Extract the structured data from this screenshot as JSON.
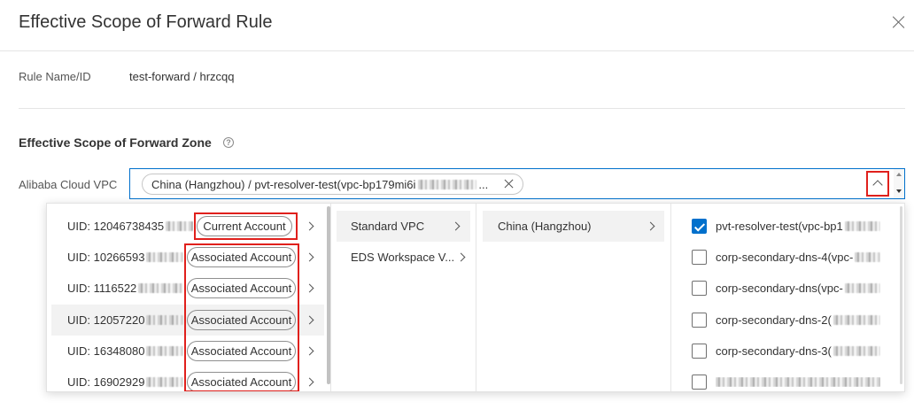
{
  "dialog": {
    "title": "Effective Scope of Forward Rule",
    "close_icon": "close-icon"
  },
  "rule": {
    "label": "Rule Name/ID",
    "value": "test-forward / hrzcqq"
  },
  "zone_section": {
    "title": "Effective Scope of Forward Zone",
    "help_icon": "question-circle-icon"
  },
  "vpc_select": {
    "label": "Alibaba Cloud VPC",
    "expanded": true,
    "toggle_icon": "chevron-up-icon",
    "selected_tag": {
      "text": "China (Hangzhou) / pvt-resolver-test(vpc-bp179mi6i",
      "ellipsis": "...",
      "remove_icon": "close-icon"
    }
  },
  "cascader": {
    "accounts": [
      {
        "uid": "UID: 12046738435",
        "badge": "Current Account",
        "hovered": false
      },
      {
        "uid": "UID: 10266593",
        "badge": "Associated Account",
        "hovered": false
      },
      {
        "uid": "UID: 1116522",
        "badge": "Associated Account",
        "hovered": false
      },
      {
        "uid": "UID: 12057220",
        "badge": "Associated Account",
        "hovered": true
      },
      {
        "uid": "UID: 16348080",
        "badge": "Associated Account",
        "hovered": false
      },
      {
        "uid": "UID: 16902929",
        "badge": "Associated Account",
        "hovered": false
      }
    ],
    "vpc_types": [
      {
        "label": "Standard VPC",
        "active": true
      },
      {
        "label": "EDS Workspace V...",
        "active": false
      }
    ],
    "regions": [
      {
        "label": "China (Hangzhou)",
        "active": true
      }
    ],
    "vpcs": [
      {
        "label": "pvt-resolver-test(vpc-bp1",
        "checked": true
      },
      {
        "label": "corp-secondary-dns-4(vpc-",
        "checked": false
      },
      {
        "label": "corp-secondary-dns(vpc-",
        "checked": false
      },
      {
        "label": "corp-secondary-dns-2(",
        "checked": false
      },
      {
        "label": "corp-secondary-dns-3(",
        "checked": false
      },
      {
        "checked": false
      }
    ],
    "expand_icon": "chevron-right-icon"
  },
  "colors": {
    "accent": "#0070cc",
    "highlight_box": "#e0201c",
    "text": "#333333",
    "hover_bg": "#f2f2f2"
  }
}
